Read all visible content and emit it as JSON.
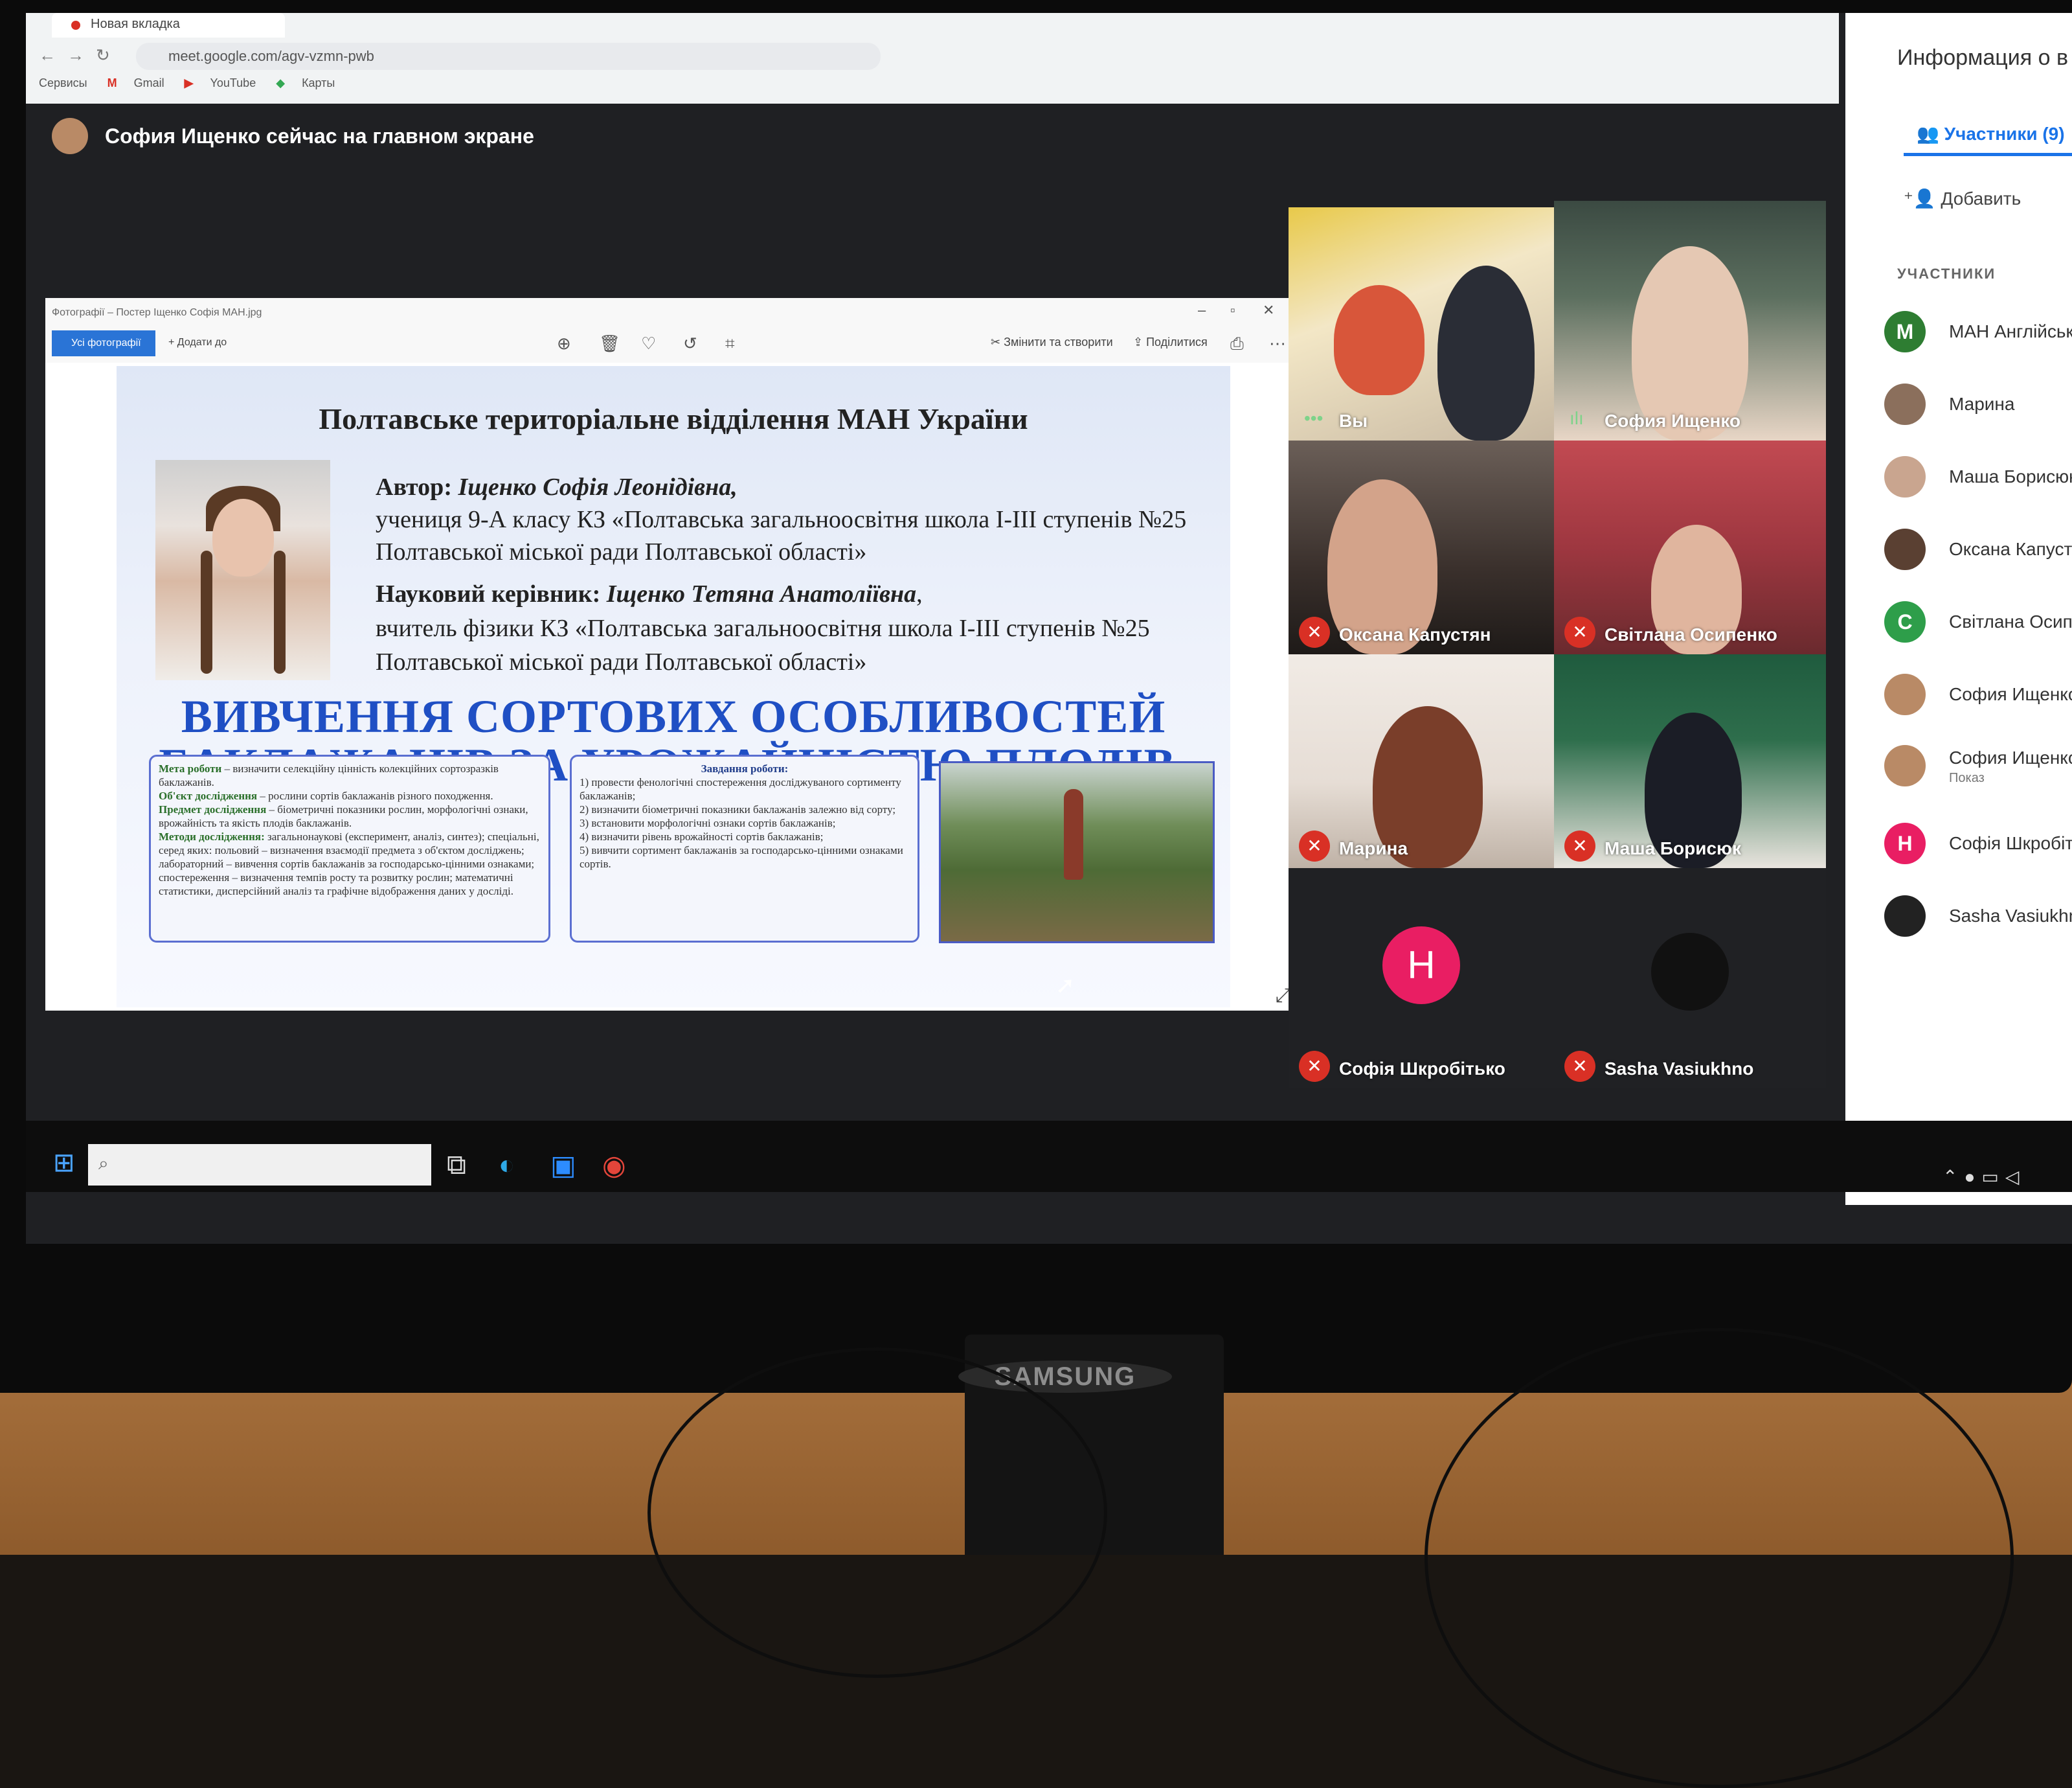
{
  "browser": {
    "tab_title": "Новая вкладка",
    "url": "meet.google.com/agv-vzmn-pwb",
    "bookmarks": [
      "Сервисы",
      "Gmail",
      "YouTube",
      "Карты"
    ]
  },
  "meet": {
    "presenter_banner": "София Ищенко сейчас на главном экране",
    "side_panel": {
      "title": "Информация о в",
      "tab_people": "Участники (9)",
      "add_label": "Добавить",
      "section_label": "УЧАСТНИКИ",
      "participants": [
        {
          "initial": "M",
          "name": "МАН Англійськ",
          "color": "#2e7d32"
        },
        {
          "initial": "",
          "name": "Марина",
          "color": "#8b6f5c"
        },
        {
          "initial": "",
          "name": "Маша Борисюк",
          "color": "#c9a58f"
        },
        {
          "initial": "",
          "name": "Оксана Капуст",
          "color": "#5a4032"
        },
        {
          "initial": "C",
          "name": "Світлана Осипе",
          "color": "#2e9e4a"
        },
        {
          "initial": "",
          "name": "София Ищенко",
          "color": "#b98a66"
        },
        {
          "initial": "",
          "name": "София Ищенко",
          "sub": "Показ",
          "color": "#b98a66"
        },
        {
          "initial": "H",
          "name": "Софія Шкробітьк",
          "color": "#e91e63"
        },
        {
          "initial": "",
          "name": "Sasha Vasiukhno",
          "color": "#222222"
        }
      ]
    },
    "tiles": [
      {
        "name": "Вы"
      },
      {
        "name": "София Ищенко"
      },
      {
        "name": "Оксана Капустян"
      },
      {
        "name": "Світлана Осипенко"
      },
      {
        "name": "Марина"
      },
      {
        "name": "Маша Борисюк"
      },
      {
        "name": "Софія Шкробітько",
        "initial": "H"
      },
      {
        "name": "Sasha Vasiukhno"
      }
    ]
  },
  "photos_app": {
    "window_title": "Фотографії – Постер Іщенко Софія МАН.jpg",
    "tab_all": "Усі фотографії",
    "add_to": "Додати до",
    "edit_create": "Змінити та створити",
    "share": "Поділитися"
  },
  "poster": {
    "title": "Полтавське територіальне відділення МАН України",
    "author_label": "Автор:",
    "author_name": "Іщенко Софія Леонідівна,",
    "author_line2": "учениця 9-А класу КЗ «Полтавська загальноосвітня школа  І-ІІІ  ступенів №25",
    "author_line3": "Полтавської міської ради Полтавської області»",
    "advisor_label": "Науковий керівник:",
    "advisor_name": "Іщенко Тетяна Анатоліївна",
    "advisor_line2": "вчитель фізики  КЗ «Полтавська загальноосвітня школа  І-ІІІ    ступенів №25",
    "advisor_line3": "Полтавської міської  ради Полтавської області»",
    "headline_1": "ВИВЧЕННЯ СОРТОВИХ ОСОБЛИВОСТЕЙ",
    "headline_2": "БАКЛАЖАНІВ ЗА УРОЖАЙНІСТЮ ПЛОДІВ.",
    "panel_left": {
      "goal_label": "Мета роботи",
      "goal": " – визначити селекційну цінність колекційних сортозразків баклажанів.",
      "object_label": "Об'єкт дослідження",
      "object": " – рослини сортів баклажанів різного походження.",
      "subject_label": "Предмет дослідження",
      "subject": " – біометричні показники рослин, морфологічні ознаки, врожайність та якість плодів баклажанів.",
      "methods_label": "Методи дослідження:",
      "methods": " загальнонаукові (експеримент, аналіз, синтез); спеціальні, серед яких: польовий – визначення взаємодії предмета з об'єктом досліджень; лабораторний – вивчення сортів баклажанів за господарсько-цінними ознаками; спостереження – визначення темпів росту та розвитку рослин; математичні статистики, дисперсійний аналіз та графічне відображення даних у досліді."
    },
    "panel_center": {
      "heading": "Завдання роботи:",
      "items": [
        "1) провести фенологічні спостереження досліджуваного сортименту баклажанів;",
        "2) визначити біометричні показники баклажанів залежно від сорту;",
        "3) встановити морфологічні ознаки сортів баклажанів;",
        "4) визначити рівень врожайності сортів баклажанів;",
        "5) вивчити сортимент баклажанів за господарсько-цінними ознаками сортів."
      ]
    }
  },
  "monitor_brand": "SAMSUNG"
}
